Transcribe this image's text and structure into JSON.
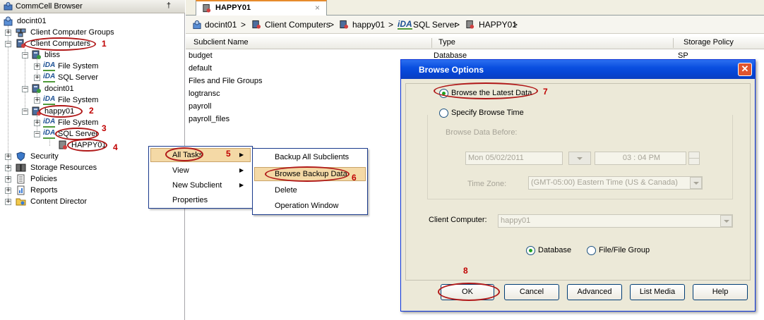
{
  "browser": {
    "title": "CommCell Browser",
    "pin": "†",
    "tree": {
      "root": "docint01",
      "client_computer_groups": "Client Computer Groups",
      "client_computers": "Client Computers",
      "bliss": "bliss",
      "bliss_fs": "File System",
      "bliss_sql": "SQL Server",
      "docint01_child": "docint01",
      "docint01_fs": "File System",
      "happy01": "happy01",
      "happy01_fs": "File System",
      "happy01_sql": "SQL Server",
      "happy01_instance": "HAPPY01",
      "security": "Security",
      "storage_resources": "Storage Resources",
      "policies": "Policies",
      "reports": "Reports",
      "content_director": "Content Director",
      "ida": "iDA"
    }
  },
  "callouts": {
    "c1": "1",
    "c2": "2",
    "c3": "3",
    "c4": "4",
    "c5": "5",
    "c6": "6",
    "c7": "7",
    "c8": "8"
  },
  "tab": {
    "label": "HAPPY01",
    "close": "×"
  },
  "breadcrumb": {
    "items": [
      "docint01",
      "Client Computers",
      "happy01",
      "SQL Server",
      "HAPPY01"
    ],
    "sep": ">"
  },
  "table": {
    "columns": [
      "Subclient Name",
      "Type",
      "Storage Policy"
    ],
    "rows": [
      [
        "budget",
        "Database",
        "SP"
      ],
      [
        "default",
        "",
        ""
      ],
      [
        "Files and File Groups",
        "",
        ""
      ],
      [
        "logtransc",
        "",
        ""
      ],
      [
        "payroll",
        "",
        ""
      ],
      [
        "payroll_files",
        "",
        ""
      ]
    ]
  },
  "context_menu": {
    "items": [
      "All Tasks",
      "View",
      "New Subclient",
      "Properties"
    ]
  },
  "submenu": {
    "items": [
      "Backup All Subclients",
      "Browse Backup Data",
      "Delete",
      "Operation Window"
    ]
  },
  "dialog": {
    "title": "Browse Options",
    "close": "✕",
    "browse_latest": "Browse the Latest Data",
    "specify_time": "Specify Browse Time",
    "browse_before_label": "Browse Data Before:",
    "date_value": "Mon 05/02/2011",
    "time_value": "03 : 04 PM",
    "timezone_label": "Time Zone:",
    "timezone_value": "(GMT-05:00) Eastern Time (US & Canada)",
    "client_label": "Client Computer:",
    "client_value": "happy01",
    "opt_database": "Database",
    "opt_filegroup": "File/File Group",
    "buttons": {
      "ok": "OK",
      "cancel": "Cancel",
      "advanced": "Advanced",
      "list_media": "List Media",
      "help": "Help"
    }
  },
  "colors": {
    "callout": "#c00000",
    "title_bar": "#0545d3",
    "menu_highlight": "#f4d9a6"
  }
}
